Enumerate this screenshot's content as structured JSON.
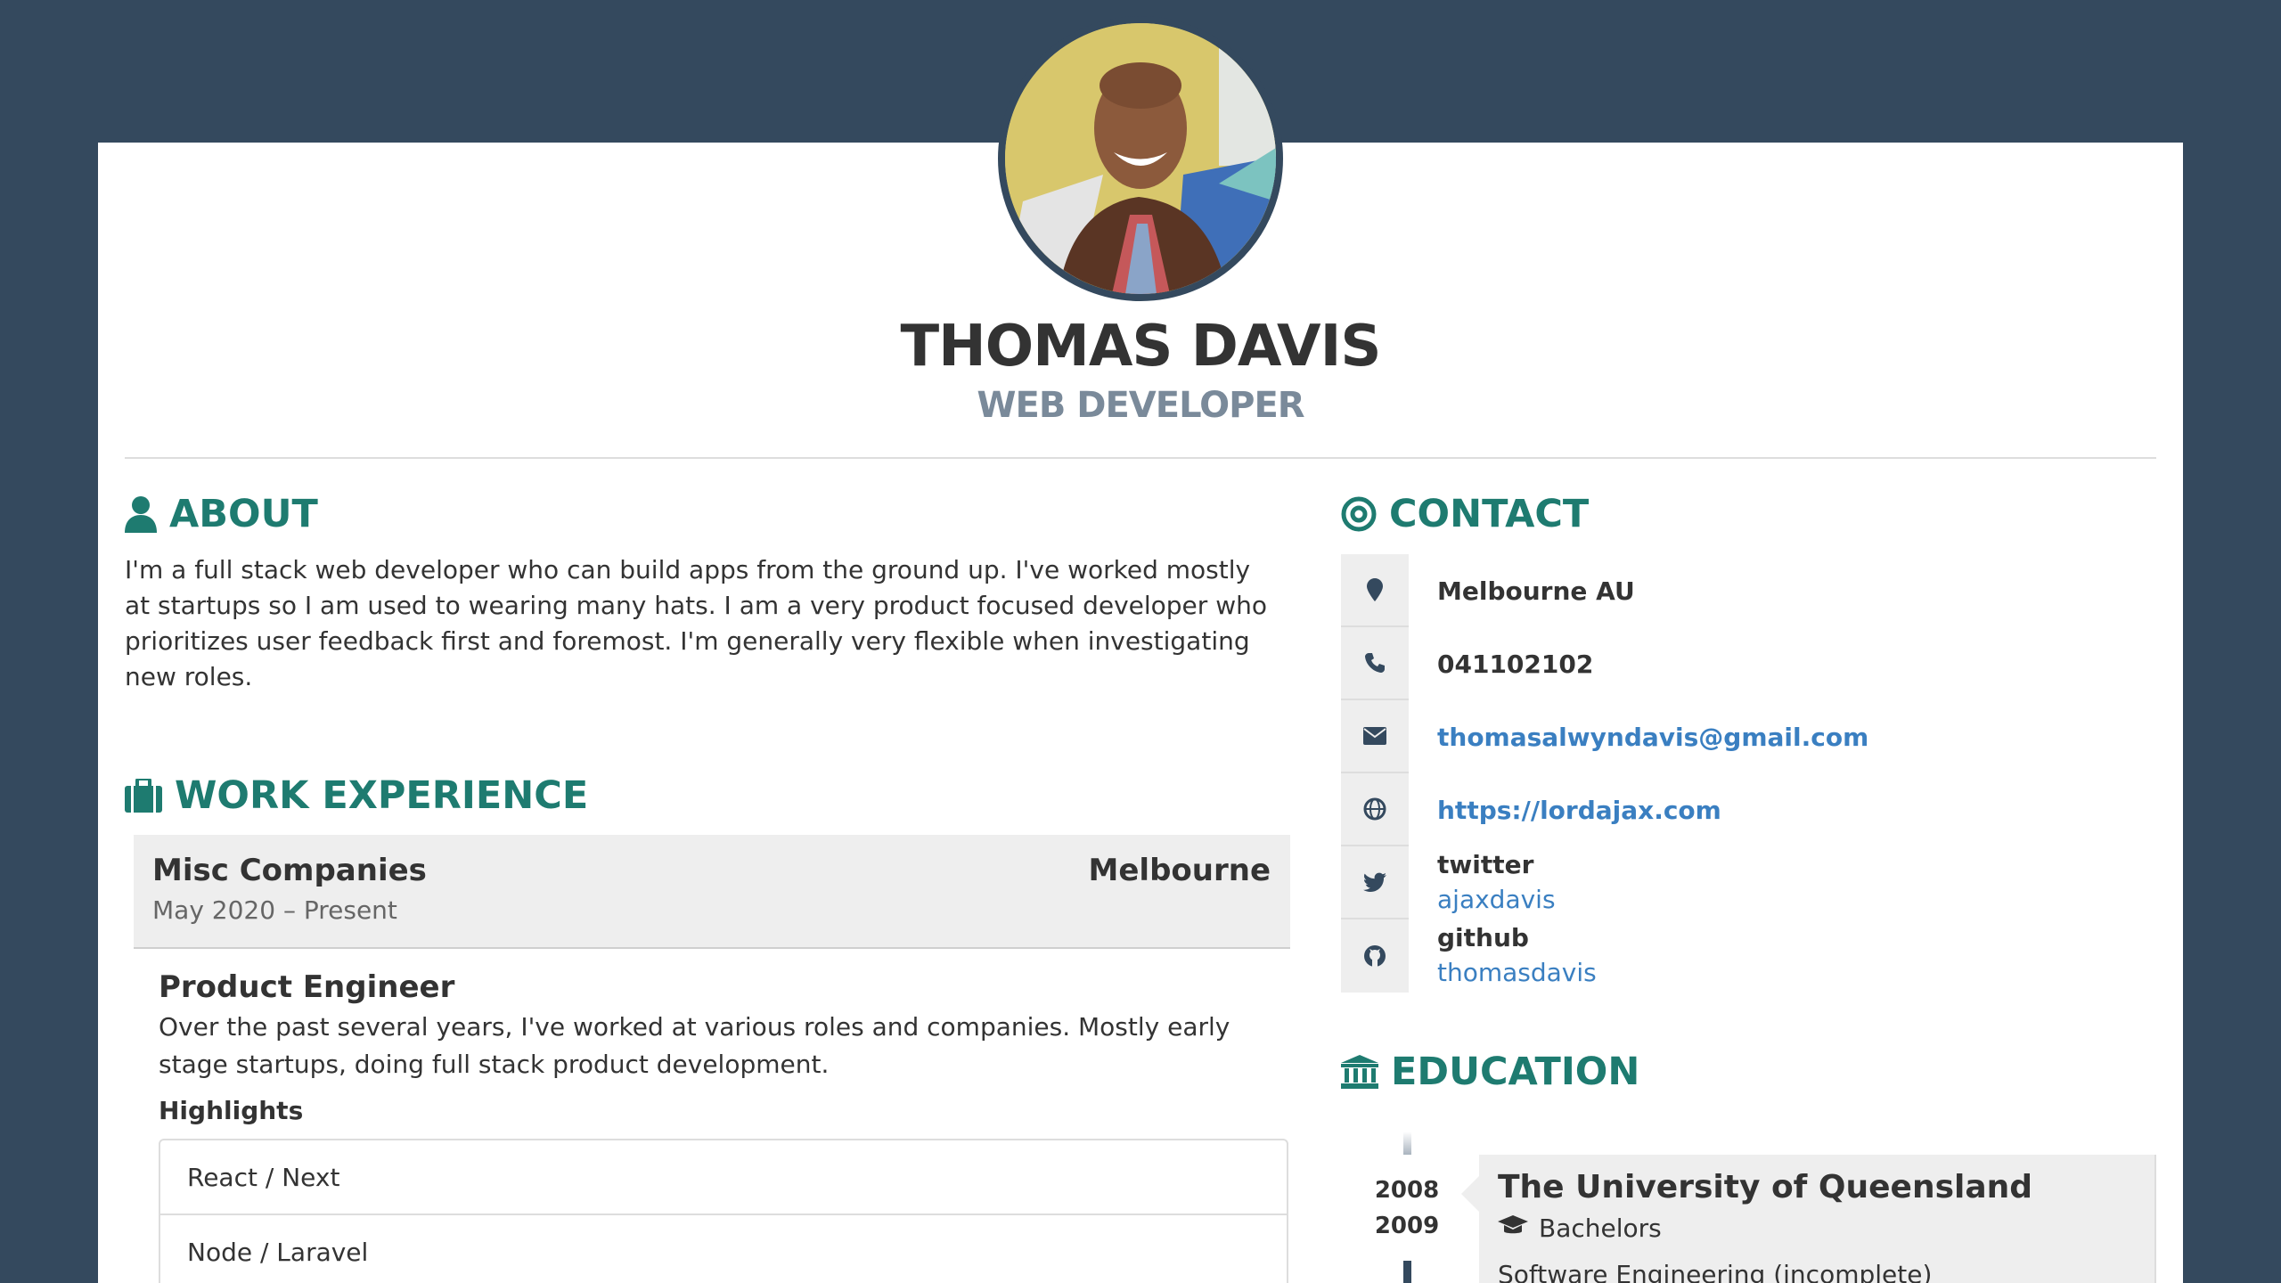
{
  "colors": {
    "background": "#34495e",
    "accent": "#1e7b70",
    "link": "#3a7fc1",
    "muted": "#7a8a9a"
  },
  "basics": {
    "name": "THOMAS DAVIS",
    "label": "WEB DEVELOPER",
    "avatar_icon": "portrait-photo"
  },
  "about": {
    "title": "ABOUT",
    "icon": "user-icon",
    "text": "I'm a full stack web developer who can build apps from the ground up. I've worked mostly at startups so I am used to wearing many hats. I am a very product focused developer who prioritizes user feedback first and foremost. I'm generally very flexible when investigating new roles."
  },
  "work": {
    "title": "WORK EXPERIENCE",
    "icon": "briefcase-icon",
    "company": "Misc Companies",
    "location": "Melbourne",
    "dates": "May 2020 – Present",
    "position": "Product Engineer",
    "summary": "Over the past several years, I've worked at various roles and companies. Mostly early stage startups, doing full stack product development.",
    "highlights_title": "Highlights",
    "highlights": [
      "React / Next",
      "Node / Laravel"
    ]
  },
  "contact": {
    "title": "CONTACT",
    "icon": "target-icon",
    "location": "Melbourne AU",
    "phone": "041102102",
    "email": "thomasalwyndavis@gmail.com",
    "website": "https://lordajax.com",
    "profiles": [
      {
        "network": "twitter",
        "username": "ajaxdavis",
        "icon": "twitter-icon"
      },
      {
        "network": "github",
        "username": "thomasdavis",
        "icon": "github-icon"
      }
    ]
  },
  "education": {
    "title": "EDUCATION",
    "icon": "institution-icon",
    "start": "2008",
    "end": "2009",
    "institution": "The University of Queensland",
    "study_type": "Bachelors",
    "area": "Software Engineering (incomplete)"
  }
}
